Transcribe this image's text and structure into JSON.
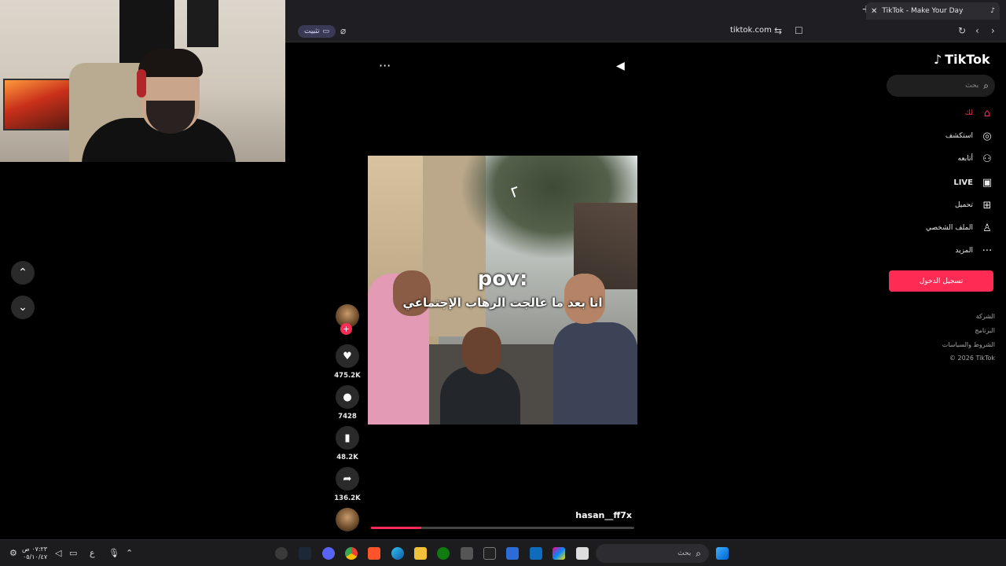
{
  "browser": {
    "tab_title": "TikTok - Make Your Day",
    "url": "tiktok.com",
    "install_label": "تثبيت"
  },
  "video": {
    "caption_line1": "pov:",
    "caption_line2": "انا بعد ما عالجت الرهاب الإجتماعي",
    "username": "hasan__ff7x",
    "progress": 0.19
  },
  "actions": {
    "likes": "475.2K",
    "comments": "7428",
    "saves": "48.2K",
    "shares": "136.2K"
  },
  "sidebar": {
    "logo": "TikTok",
    "search_placeholder": "بحث",
    "items": [
      {
        "label": "لك",
        "icon": "home-icon"
      },
      {
        "label": "استكشف",
        "icon": "compass-icon"
      },
      {
        "label": "أتابعه",
        "icon": "following-icon"
      },
      {
        "label": "LIVE",
        "icon": "live-icon"
      },
      {
        "label": "تحميل",
        "icon": "upload-icon"
      },
      {
        "label": "الملف الشخصي",
        "icon": "profile-icon"
      },
      {
        "label": "المزيد",
        "icon": "more-icon"
      }
    ],
    "login_label": "تسجيل الدخول",
    "footer": [
      "الشركة",
      "البرنامج",
      "الشروط والسياسات",
      "© 2026 TikTok"
    ]
  },
  "taskbar": {
    "search_placeholder": "بحث",
    "time": "٠٧:٢٣ ص",
    "date": "٠٥/١٠/٤٧",
    "lang": "ع"
  },
  "colors": {
    "accent": "#fe2c55",
    "background": "#000000",
    "chrome": "#1f1f23"
  }
}
